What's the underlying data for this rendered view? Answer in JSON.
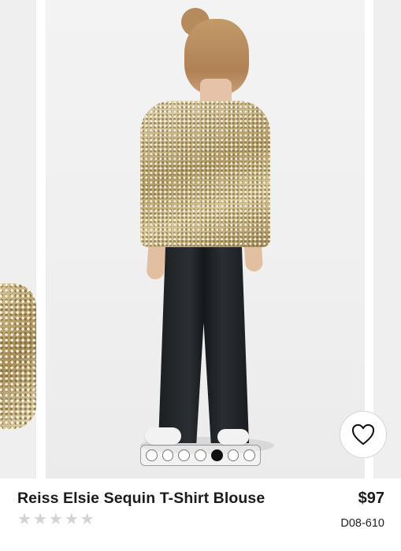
{
  "product": {
    "title": "Reiss Elsie Sequin T-Shirt Blouse",
    "price": "$97",
    "sku": "D08-610",
    "rating": 0,
    "rating_max": 5
  },
  "carousel": {
    "dot_count": 7,
    "active_index": 4
  },
  "icons": {
    "favorite": "heart-icon",
    "star": "star-icon"
  },
  "colors": {
    "text": "#1b1b1b",
    "star_empty": "#d3d3d3",
    "dot_active": "#111111"
  }
}
